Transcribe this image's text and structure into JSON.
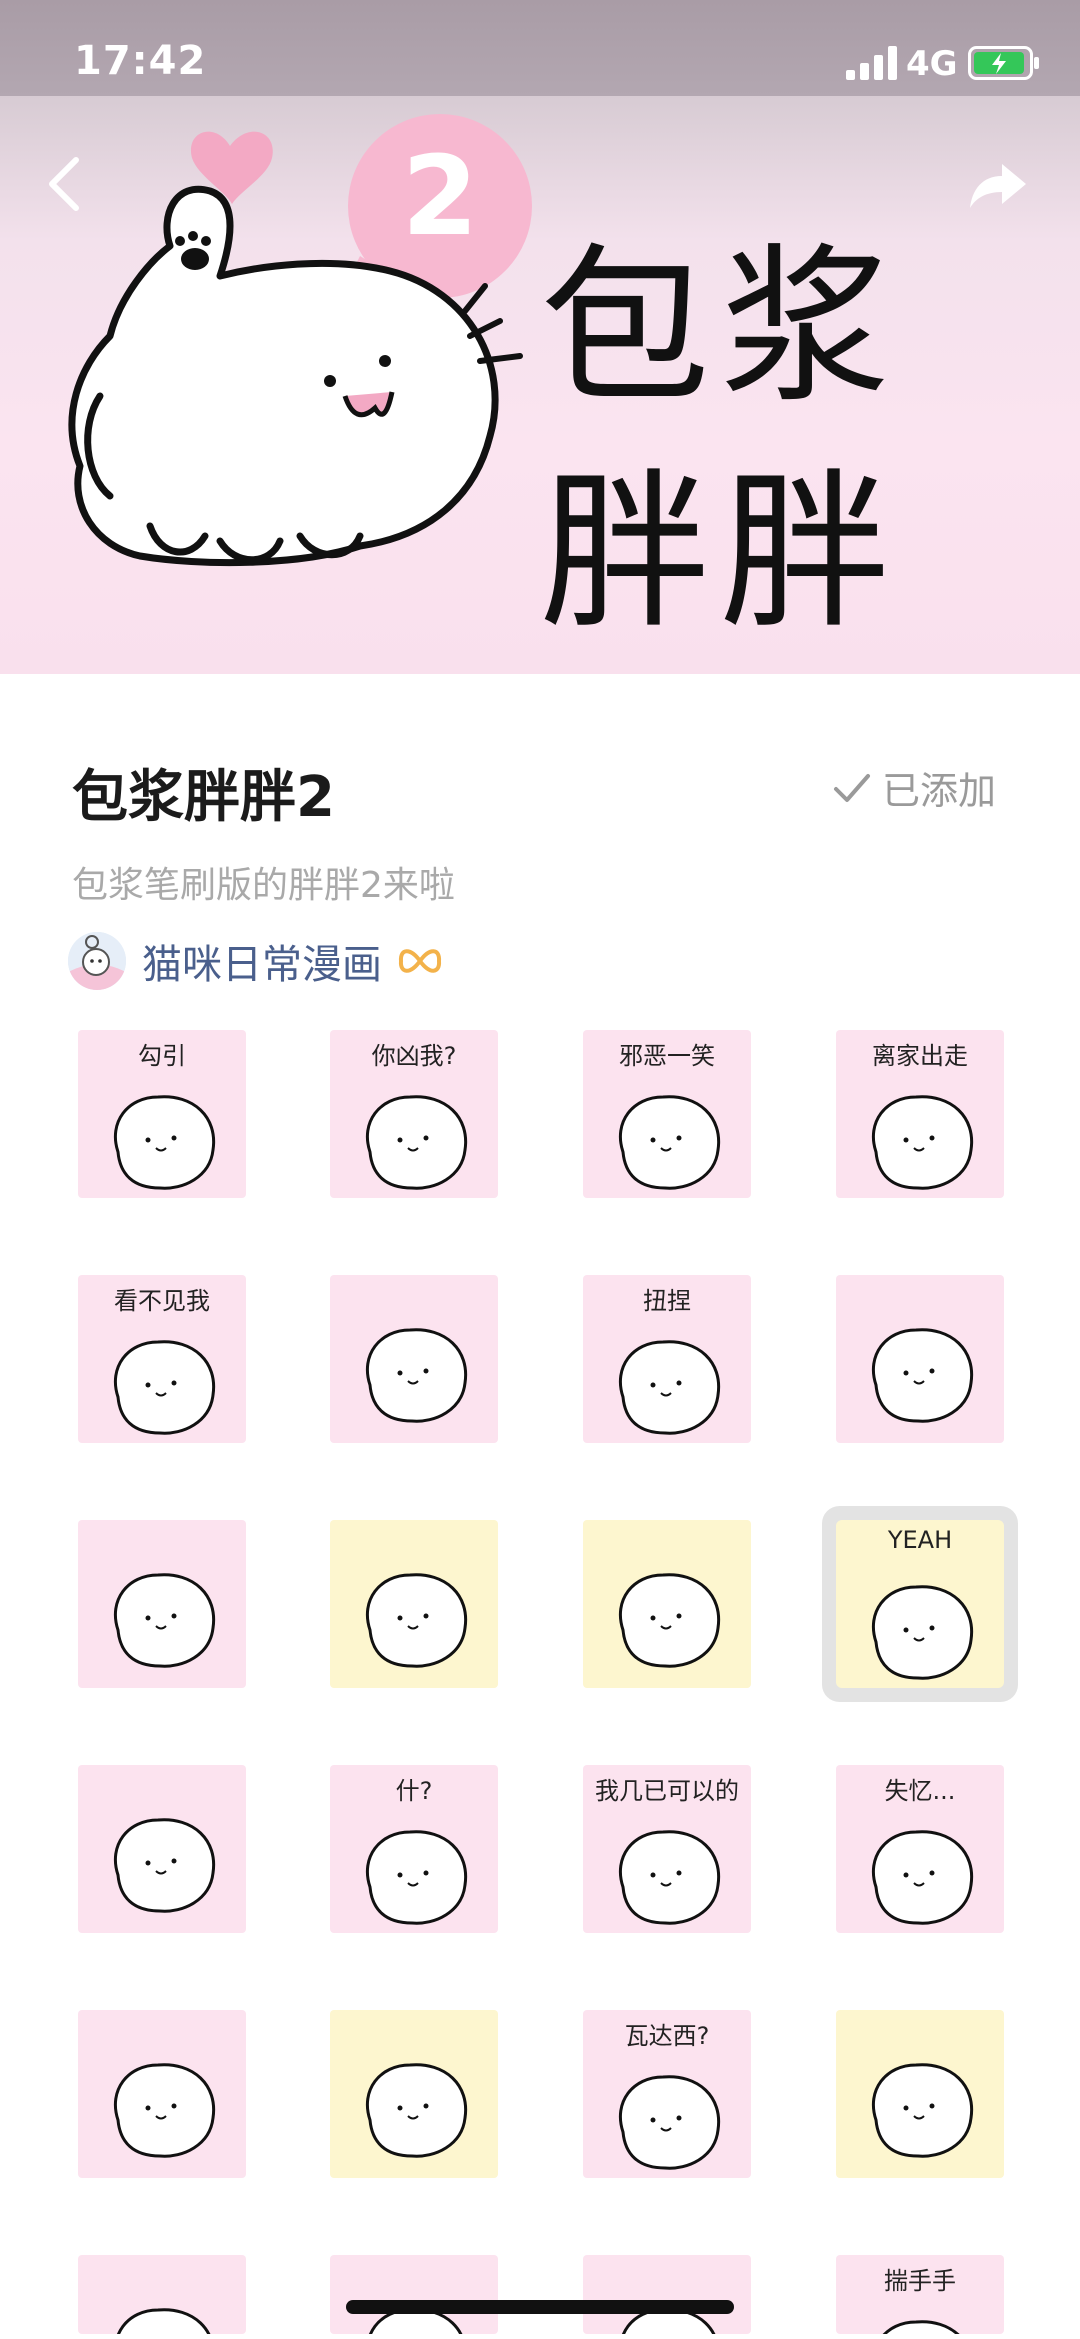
{
  "status_bar": {
    "time": "17:42",
    "network": "4G",
    "battery_color": "#34c759"
  },
  "banner": {
    "badge_number": "2",
    "title_text": "包浆胖胖",
    "back_icon": "chevron-left-icon",
    "share_icon": "share-arrow-icon",
    "colors": {
      "top": "#d7cbd3",
      "bottom": "#fbe4f0",
      "heart": "#f3a9c4",
      "badge": "#f7b8d0"
    }
  },
  "pack": {
    "title": "包浆胖胖2",
    "added_label": "已添加",
    "description": "包浆笔刷版的胖胖2来啦",
    "author": {
      "name": "猫咪日常漫画",
      "badge_icon": "bow-icon",
      "badge_color": "#f3b24a"
    }
  },
  "stickers": [
    {
      "caption": "勾引",
      "bg": "#fce3ef"
    },
    {
      "caption": "你凶我?",
      "bg": "#fce3ef"
    },
    {
      "caption": "邪恶一笑",
      "bg": "#fce3ef"
    },
    {
      "caption": "离家出走",
      "bg": "#fce3ef"
    },
    {
      "caption": "看不见我",
      "bg": "#fce3ef"
    },
    {
      "caption": "",
      "bg": "#fce3ef"
    },
    {
      "caption": "扭捏",
      "bg": "#fce3ef"
    },
    {
      "caption": "",
      "bg": "#fce3ef"
    },
    {
      "caption": "",
      "bg": "#fce3ef"
    },
    {
      "caption": "",
      "bg": "#fdf6cf"
    },
    {
      "caption": "",
      "bg": "#fdf6cf"
    },
    {
      "caption": "YEAH",
      "bg": "#fdf6cf",
      "selected": true
    },
    {
      "caption": "",
      "bg": "#fce3ef"
    },
    {
      "caption": "什?",
      "bg": "#fce3ef"
    },
    {
      "caption": "我几已可以的",
      "bg": "#fce3ef"
    },
    {
      "caption": "失忆...",
      "bg": "#fce3ef"
    },
    {
      "caption": "",
      "bg": "#fce3ef"
    },
    {
      "caption": "",
      "bg": "#fdf6cf"
    },
    {
      "caption": "瓦达西?",
      "bg": "#fce3ef"
    },
    {
      "caption": "",
      "bg": "#fdf6cf"
    },
    {
      "caption": "",
      "bg": "#fce3ef"
    },
    {
      "caption": "",
      "bg": "#fce3ef"
    },
    {
      "caption": "",
      "bg": "#fce3ef"
    },
    {
      "caption": "揣手手",
      "bg": "#fce3ef"
    }
  ]
}
